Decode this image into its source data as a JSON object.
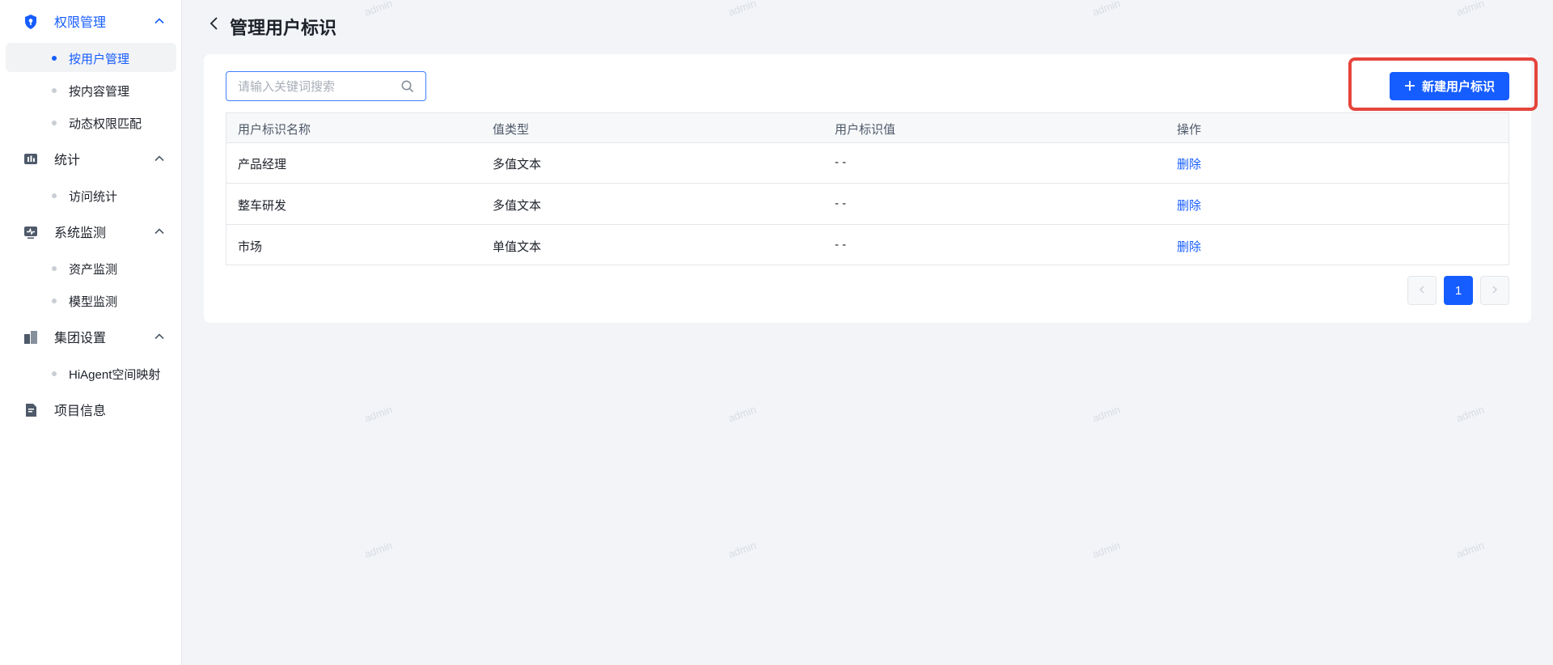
{
  "sidebar": {
    "groups": [
      {
        "label": "权限管理",
        "icon": "shield-icon",
        "active": true,
        "items": [
          {
            "label": "按用户管理",
            "active": true
          },
          {
            "label": "按内容管理",
            "active": false
          },
          {
            "label": "动态权限匹配",
            "active": false
          }
        ]
      },
      {
        "label": "统计",
        "icon": "bar-chart-icon",
        "items": [
          {
            "label": "访问统计"
          }
        ]
      },
      {
        "label": "系统监测",
        "icon": "monitor-icon",
        "items": [
          {
            "label": "资产监测"
          },
          {
            "label": "模型监测"
          }
        ]
      },
      {
        "label": "集团设置",
        "icon": "building-icon",
        "items": [
          {
            "label": "HiAgent空间映射"
          }
        ]
      },
      {
        "label": "项目信息",
        "icon": "document-icon",
        "items": []
      }
    ]
  },
  "header": {
    "title": "管理用户标识",
    "back_icon": "chevron-left-icon"
  },
  "toolbar": {
    "search_placeholder": "请输入关键词搜索",
    "search_value": "",
    "new_button_label": "新建用户标识",
    "new_button_icon": "plus-icon"
  },
  "table": {
    "columns": [
      "用户标识名称",
      "值类型",
      "用户标识值",
      "操作"
    ],
    "rows": [
      {
        "name": "产品经理",
        "type": "多值文本",
        "value": "- -",
        "action": "删除"
      },
      {
        "name": "整车研发",
        "type": "多值文本",
        "value": "- -",
        "action": "删除"
      },
      {
        "name": "市场",
        "type": "单值文本",
        "value": "- -",
        "action": "删除"
      }
    ]
  },
  "pagination": {
    "prev_icon": "chevron-left-icon",
    "current": "1",
    "next_icon": "chevron-right-icon"
  },
  "watermark": "admin",
  "colors": {
    "primary": "#165dff",
    "highlight": "#e5453c",
    "background": "#f2f4f8"
  }
}
